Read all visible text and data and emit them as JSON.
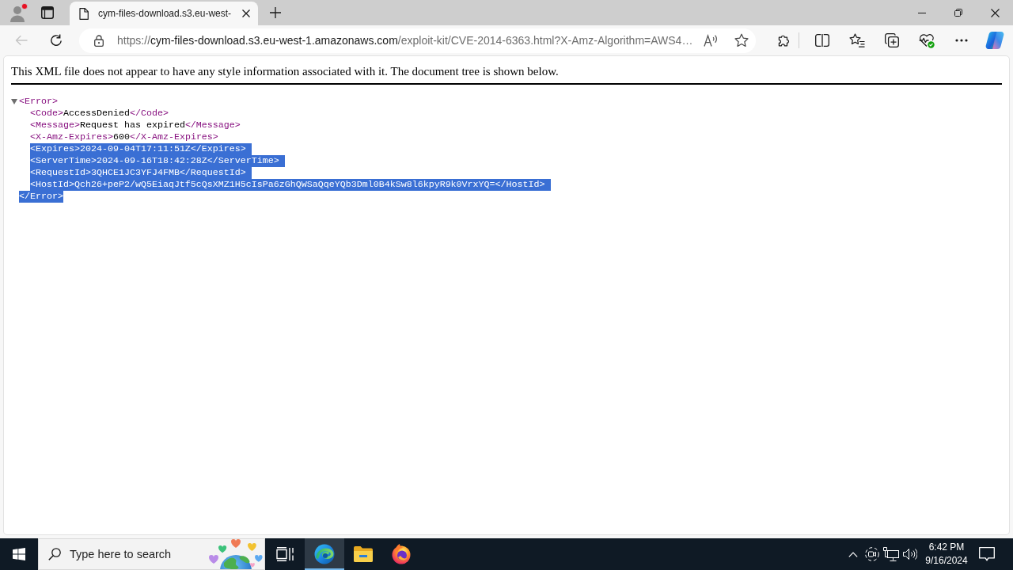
{
  "browser": {
    "profile": {
      "notification": true
    },
    "tabs": [
      {
        "title": "cym-files-download.s3.eu-west-",
        "selected": true
      }
    ],
    "toolbar": {
      "back_disabled": true,
      "url_parts": [
        {
          "text": "https://",
          "emphasis": false
        },
        {
          "text": "cym-files-download.s3.eu-west-1.amazonaws.com",
          "emphasis": true
        },
        {
          "text": "/exploit-kit/CVE-2014-6363.html?X-Amz-Algorithm=AWS4…",
          "emphasis": false
        }
      ]
    }
  },
  "page": {
    "notice": "This XML file does not appear to have any style information associated with it. The document tree is shown below.",
    "xml_tree": {
      "open_tag": "<Error>",
      "open_highlighted": false,
      "expanded": true,
      "children": [
        {
          "open_tag": "<Code>",
          "value": "AccessDenied",
          "close_tag": "</Code>",
          "highlighted": false
        },
        {
          "open_tag": "<Message>",
          "value": "Request has expired",
          "close_tag": "</Message>",
          "highlighted": false
        },
        {
          "open_tag": "<X-Amz-Expires>",
          "value": "600",
          "close_tag": "</X-Amz-Expires>",
          "highlighted": false
        },
        {
          "open_tag": "<Expires>",
          "value": "2024-09-04T17:11:51Z",
          "close_tag": "</Expires>",
          "highlighted": true
        },
        {
          "open_tag": "<ServerTime>",
          "value": "2024-09-16T18:42:28Z",
          "close_tag": "</ServerTime>",
          "highlighted": true
        },
        {
          "open_tag": "<RequestId>",
          "value": "3QHCE1JC3YFJ4FMB",
          "close_tag": "</RequestId>",
          "highlighted": true
        },
        {
          "open_tag": "<HostId>",
          "value": "Qch26+peP2/wQ5EiaqJtf5cQsXMZ1H5cIsPa6zGhQWSaQqeYQb3Dml0B4kSw8l6kpyR9k0VrxYQ=",
          "close_tag": "</HostId>",
          "highlighted": true
        }
      ],
      "close_tag": "</Error>",
      "close_highlighted": true
    }
  },
  "taskbar": {
    "search": {
      "placeholder": "Type here to search"
    },
    "apps": [
      {
        "kind": "edge",
        "active": true
      },
      {
        "kind": "explorer",
        "active": false
      },
      {
        "kind": "firefox",
        "active": false
      }
    ],
    "clock": {
      "time": "6:42 PM",
      "date": "9/16/2024"
    }
  }
}
